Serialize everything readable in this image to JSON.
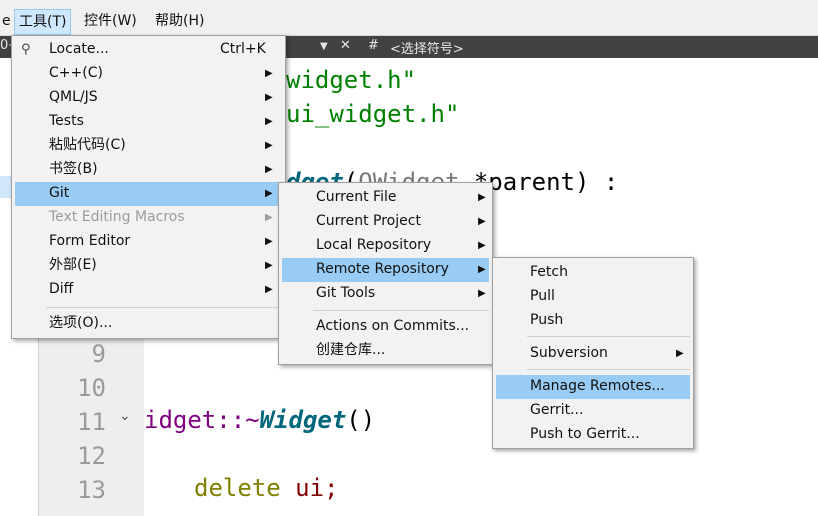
{
  "menubar": {
    "fragment": "e",
    "items": [
      "工具(T)",
      "控件(W)",
      "帮助(H)"
    ]
  },
  "editor_bar": {
    "left_fragment": "0+",
    "dropdown_arrow": "▼",
    "close": "✕",
    "hash": "#",
    "symbol_placeholder": "<选择符号>"
  },
  "editor": {
    "line_numbers": [
      "9",
      "10",
      "11",
      "12",
      "13"
    ],
    "code": {
      "include1": "widget.h\"",
      "include2": "ui_widget.h\"",
      "ctor_fn": "dget",
      "ctor_paren": "(",
      "ctor_type": "QWidget",
      "ctor_rest": " *parent) :",
      "dtor_name": "idget::~",
      "dtor_fn": "Widget",
      "dtor_paren": "()",
      "delete_kw": "delete",
      "delete_rest": " ui;"
    }
  },
  "tools_menu": {
    "items": [
      {
        "label": "Locate...",
        "shortcut": "Ctrl+K"
      },
      {
        "label": "C++(C)"
      },
      {
        "label": "QML/JS"
      },
      {
        "label": "Tests"
      },
      {
        "label": "粘贴代码(C)"
      },
      {
        "label": "书签(B)"
      },
      {
        "label": "Git"
      },
      {
        "label": "Text Editing Macros"
      },
      {
        "label": "Form Editor"
      },
      {
        "label": "外部(E)"
      },
      {
        "label": "Diff"
      },
      {
        "label": "选项(O)..."
      }
    ]
  },
  "git_menu": {
    "items": [
      {
        "label": "Current File"
      },
      {
        "label": "Current Project"
      },
      {
        "label": "Local Repository"
      },
      {
        "label": "Remote Repository"
      },
      {
        "label": "Git Tools"
      },
      {
        "label": "Actions on Commits..."
      },
      {
        "label": "创建仓库..."
      }
    ]
  },
  "remote_menu": {
    "items": [
      {
        "label": "Fetch"
      },
      {
        "label": "Pull"
      },
      {
        "label": "Push"
      },
      {
        "label": "Subversion"
      },
      {
        "label": "Manage Remotes..."
      },
      {
        "label": "Gerrit..."
      },
      {
        "label": "Push to Gerrit..."
      }
    ]
  },
  "icons": {
    "submenu_arrow": "▶",
    "fold_arrow": "⌄",
    "search": "search-icon"
  },
  "colors": {
    "highlight": "#99ccf5",
    "menu_bg": "#f2f2f2",
    "string": "#008000",
    "keyword": "#808000"
  }
}
